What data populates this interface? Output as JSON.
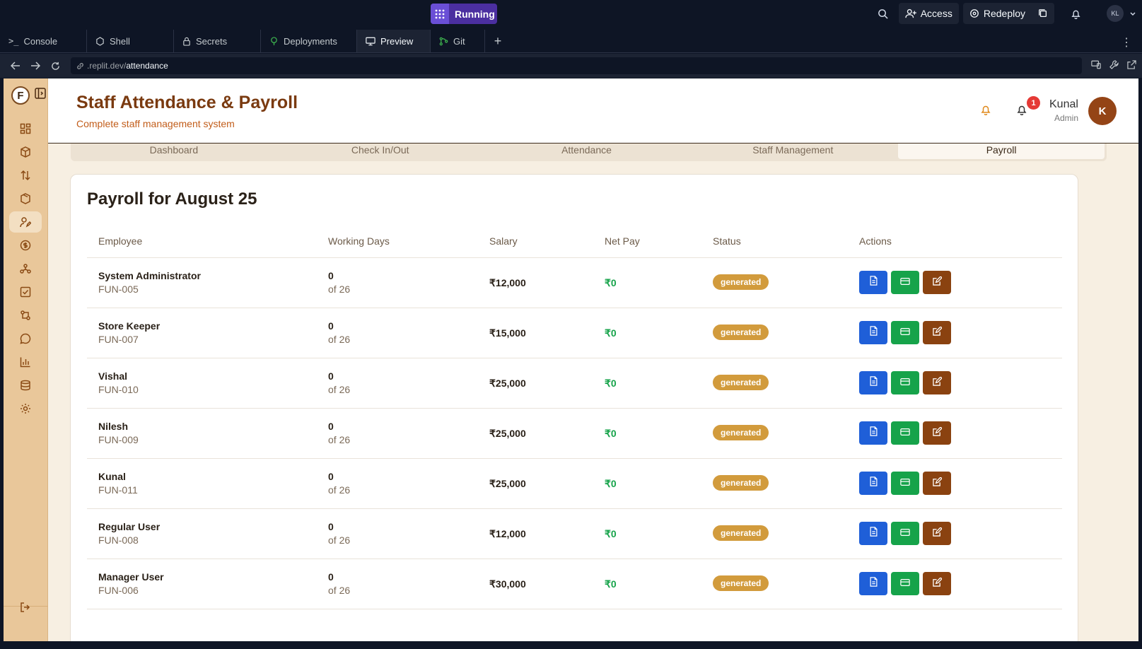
{
  "topbar": {
    "run_label": "Running",
    "access_label": "Access",
    "redeploy_label": "Redeploy",
    "user_initials": "KL"
  },
  "tabs": [
    {
      "label": "Console",
      "icon": "terminal-icon"
    },
    {
      "label": "Shell",
      "icon": "shell-icon"
    },
    {
      "label": "Secrets",
      "icon": "lock-icon"
    },
    {
      "label": "Deployments",
      "icon": "deploy-icon"
    },
    {
      "label": "Preview",
      "icon": "monitor-icon"
    },
    {
      "label": "Git",
      "icon": "git-icon"
    }
  ],
  "url": {
    "prefix": ".replit.dev/",
    "path": "attendance"
  },
  "sidebar": {
    "logo": "F"
  },
  "header": {
    "title": "Staff Attendance & Payroll",
    "subtitle": "Complete staff management system",
    "notification_count": "1",
    "user_name": "Kunal",
    "user_role": "Admin",
    "avatar_letter": "K"
  },
  "nav": {
    "tabs": [
      "Dashboard",
      "Check In/Out",
      "Attendance",
      "Staff Management",
      "Payroll"
    ],
    "active": "Payroll"
  },
  "payroll": {
    "title": "Payroll for August 25",
    "columns": [
      "Employee",
      "Working Days",
      "Salary",
      "Net Pay",
      "Status",
      "Actions"
    ],
    "rows": [
      {
        "name": "System Administrator",
        "id": "FUN-005",
        "days": "0",
        "of": "of 26",
        "salary": "₹12,000",
        "net": "₹0",
        "status": "generated"
      },
      {
        "name": "Store Keeper",
        "id": "FUN-007",
        "days": "0",
        "of": "of 26",
        "salary": "₹15,000",
        "net": "₹0",
        "status": "generated"
      },
      {
        "name": "Vishal",
        "id": "FUN-010",
        "days": "0",
        "of": "of 26",
        "salary": "₹25,000",
        "net": "₹0",
        "status": "generated"
      },
      {
        "name": "Nilesh",
        "id": "FUN-009",
        "days": "0",
        "of": "of 26",
        "salary": "₹25,000",
        "net": "₹0",
        "status": "generated"
      },
      {
        "name": "Kunal",
        "id": "FUN-011",
        "days": "0",
        "of": "of 26",
        "salary": "₹25,000",
        "net": "₹0",
        "status": "generated"
      },
      {
        "name": "Regular User",
        "id": "FUN-008",
        "days": "0",
        "of": "of 26",
        "salary": "₹12,000",
        "net": "₹0",
        "status": "generated"
      },
      {
        "name": "Manager User",
        "id": "FUN-006",
        "days": "0",
        "of": "of 26",
        "salary": "₹30,000",
        "net": "₹0",
        "status": "generated"
      }
    ]
  }
}
